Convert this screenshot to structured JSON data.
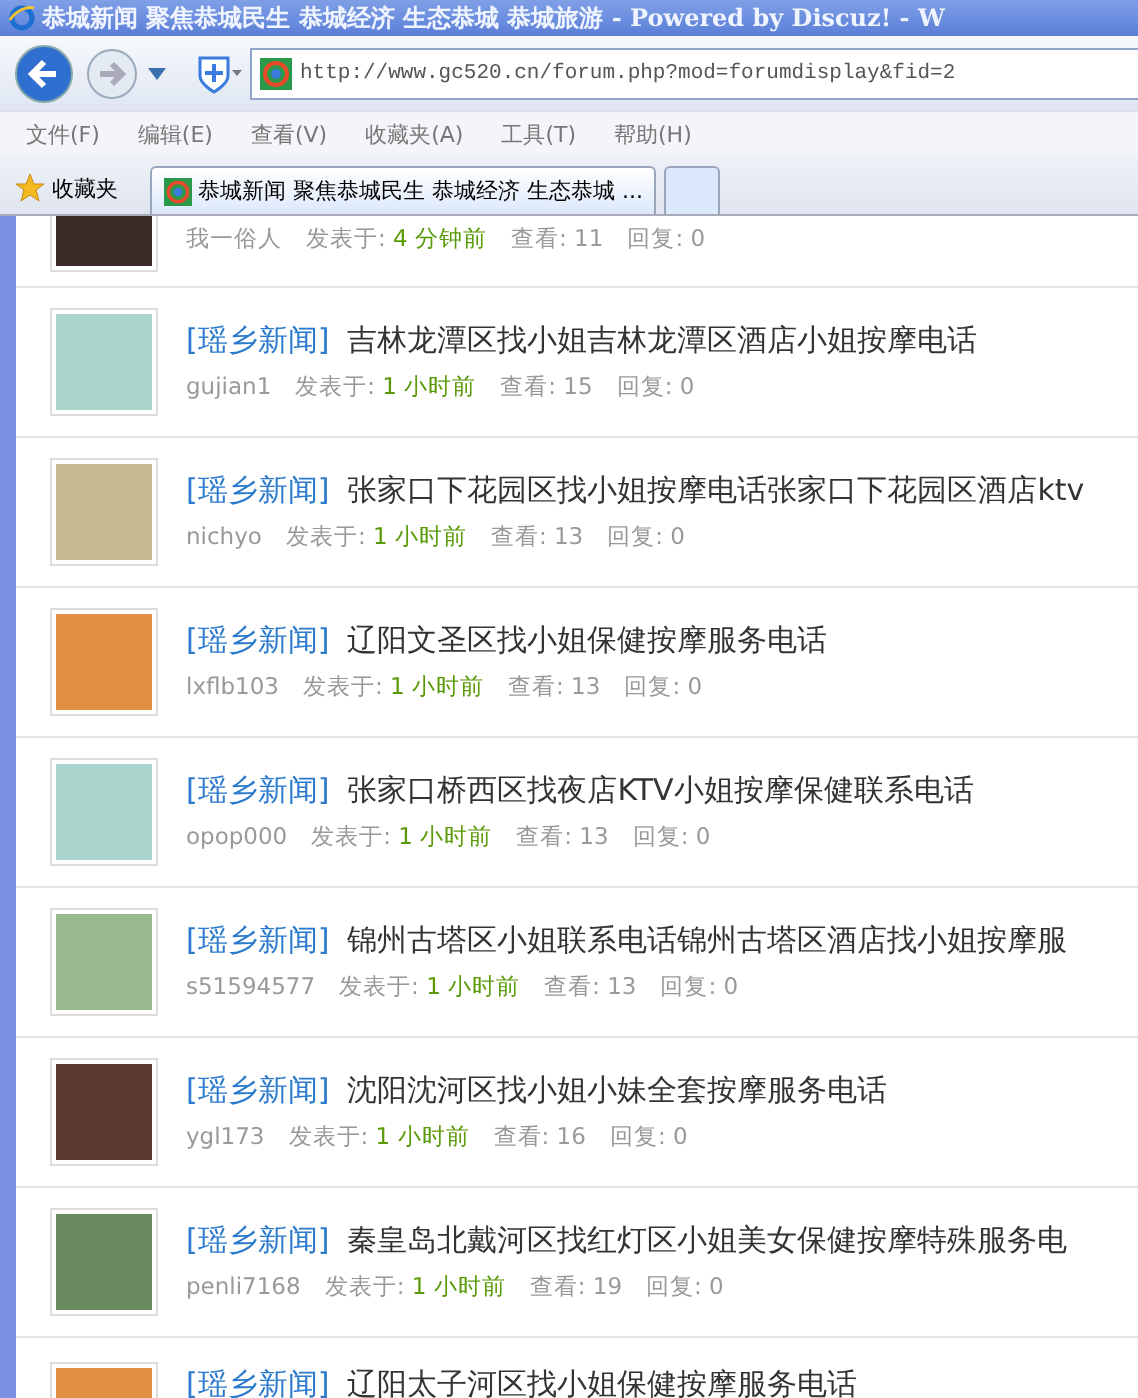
{
  "window": {
    "title": "恭城新闻 聚焦恭城民生 恭城经济 生态恭城 恭城旅游 - Powered by Discuz! - W"
  },
  "address_bar": {
    "value": "http://www.gc520.cn/forum.php?mod=forumdisplay&fid=2"
  },
  "menu": [
    "文件(F)",
    "编辑(E)",
    "查看(V)",
    "收藏夹(A)",
    "工具(T)",
    "帮助(H)"
  ],
  "favorites": {
    "label": "收藏夹"
  },
  "tabs": [
    {
      "label": "恭城新闻 聚焦恭城民生 恭城经济 生态恭城 ...",
      "selected": true
    }
  ],
  "posts": [
    {
      "author": "我一俗人",
      "posted_label": "发表于:",
      "time": "4 分钟前",
      "views": "查看: 11",
      "replies": "回复: 0"
    },
    {
      "category": "[瑶乡新闻]",
      "title": "吉林龙潭区找小姐吉林龙潭区酒店小姐按摩电话",
      "author": "gujian1",
      "posted_label": "发表于:",
      "time": "1 小时前",
      "views": "查看: 15",
      "replies": "回复: 0"
    },
    {
      "category": "[瑶乡新闻]",
      "title": "张家口下花园区找小姐按摩电话张家口下花园区酒店ktv",
      "author": "nichyo",
      "posted_label": "发表于:",
      "time": "1 小时前",
      "views": "查看: 13",
      "replies": "回复: 0"
    },
    {
      "category": "[瑶乡新闻]",
      "title": "辽阳文圣区找小姐保健按摩服务电话",
      "author": "lxflb103",
      "posted_label": "发表于:",
      "time": "1 小时前",
      "views": "查看: 13",
      "replies": "回复: 0"
    },
    {
      "category": "[瑶乡新闻]",
      "title": "张家口桥西区找夜店KTV小姐按摩保健联系电话",
      "author": "opop000",
      "posted_label": "发表于:",
      "time": "1 小时前",
      "views": "查看: 13",
      "replies": "回复: 0"
    },
    {
      "category": "[瑶乡新闻]",
      "title": "锦州古塔区小姐联系电话锦州古塔区酒店找小姐按摩服",
      "author": "s51594577",
      "posted_label": "发表于:",
      "time": "1 小时前",
      "views": "查看: 13",
      "replies": "回复: 0"
    },
    {
      "category": "[瑶乡新闻]",
      "title": "沈阳沈河区找小姐小妹全套按摩服务电话",
      "author": "ygl173",
      "posted_label": "发表于:",
      "time": "1 小时前",
      "views": "查看: 16",
      "replies": "回复: 0"
    },
    {
      "category": "[瑶乡新闻]",
      "title": "秦皇岛北戴河区找红灯区小姐美女保健按摩特殊服务电",
      "author": "penli7168",
      "posted_label": "发表于:",
      "time": "1 小时前",
      "views": "查看: 19",
      "replies": "回复: 0"
    },
    {
      "category": "[瑶乡新闻]",
      "title": "辽阳太子河区找小姐保健按摩服务电话"
    }
  ]
}
